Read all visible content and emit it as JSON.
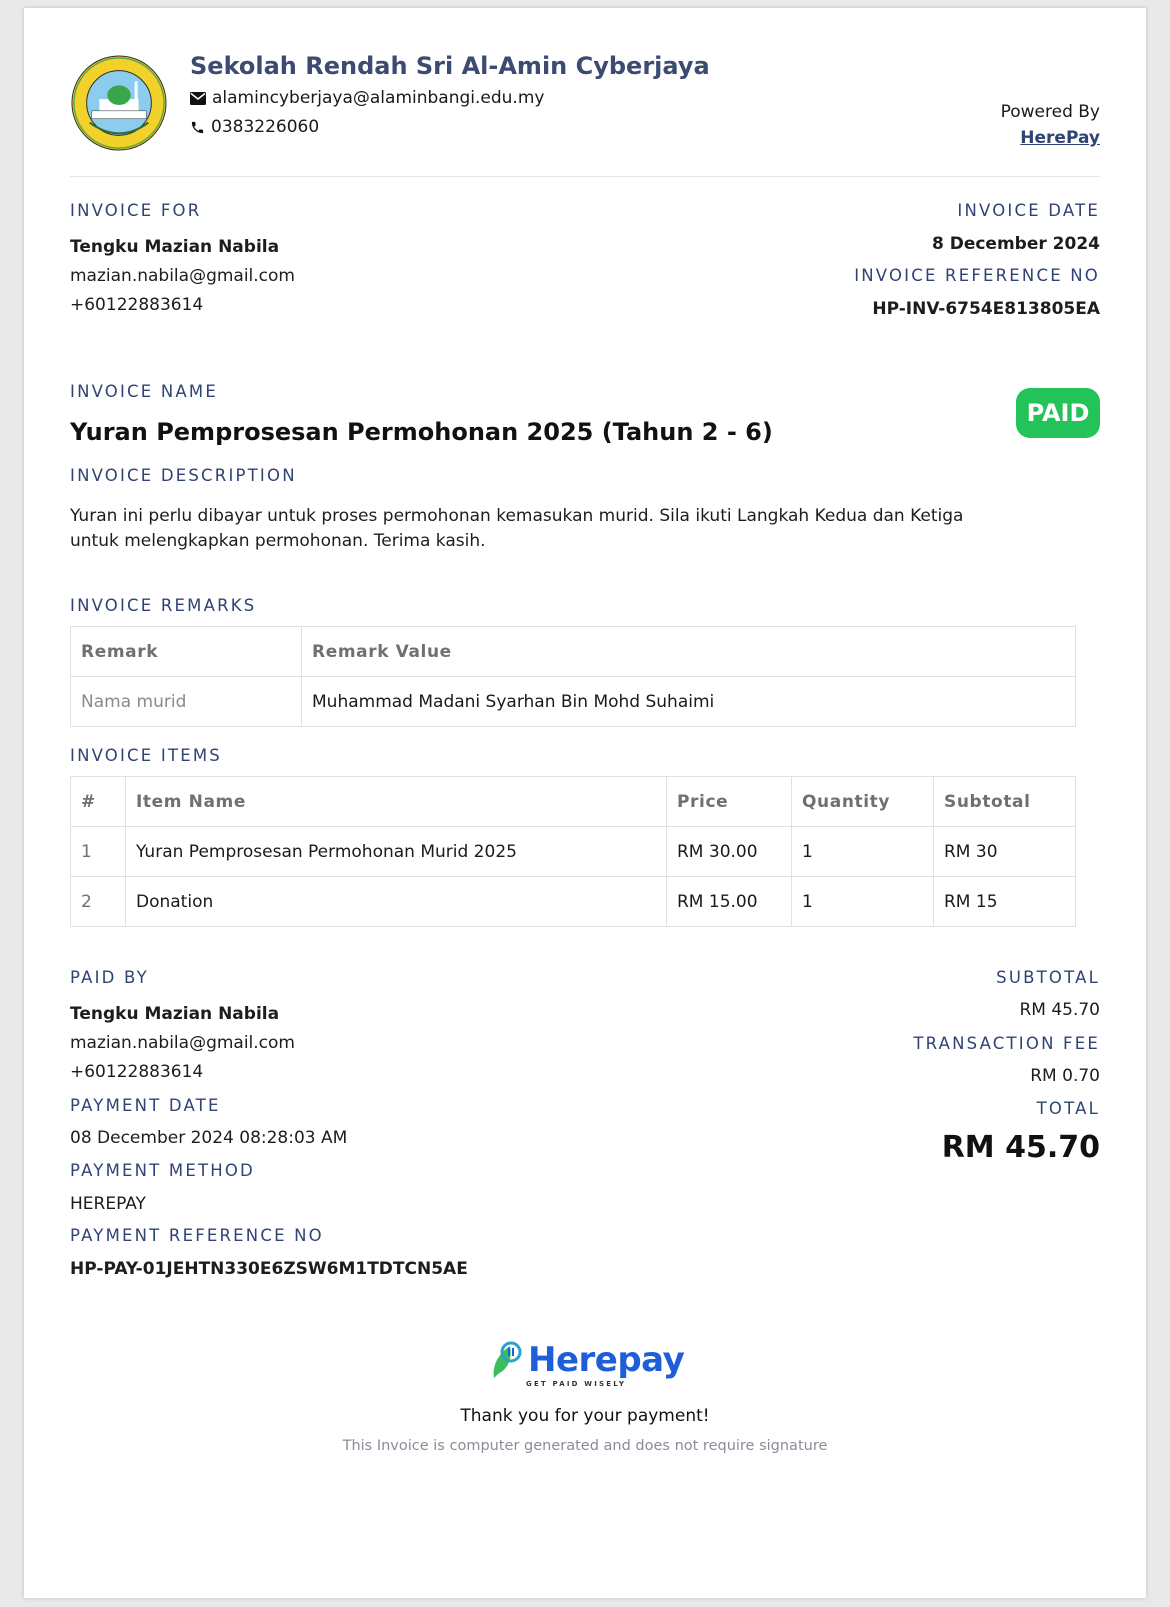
{
  "school": {
    "name": "Sekolah Rendah Sri Al-Amin Cyberjaya",
    "email": "alamincyberjaya@alaminbangi.edu.my",
    "phone": "0383226060",
    "logo_text": "SEKOLAH RENDAH SRI AL-AMIN CYBERJAYA"
  },
  "powered": {
    "label": "Powered By",
    "link": "HerePay"
  },
  "invoice_for": {
    "label": "INVOICE FOR",
    "name": "Tengku Mazian Nabila",
    "email": "mazian.nabila@gmail.com",
    "phone": "+60122883614"
  },
  "invoice_date": {
    "label": "INVOICE DATE",
    "value": "8 December 2024"
  },
  "invoice_ref": {
    "label": "INVOICE REFERENCE NO",
    "value": "HP-INV-6754E813805EA"
  },
  "invoice_name": {
    "label": "INVOICE NAME",
    "value": "Yuran Pemprosesan Permohonan 2025 (Tahun 2 - 6)"
  },
  "status_badge": {
    "text": "PAID",
    "color": "#24c35a"
  },
  "invoice_description": {
    "label": "INVOICE DESCRIPTION",
    "value": "Yuran ini perlu dibayar untuk proses permohonan kemasukan murid. Sila ikuti Langkah Kedua dan Ketiga untuk melengkapkan permohonan. Terima kasih."
  },
  "remarks": {
    "label": "INVOICE REMARKS",
    "headers": [
      "Remark",
      "Remark Value"
    ],
    "rows": [
      [
        "Nama murid",
        "Muhammad Madani Syarhan Bin Mohd Suhaimi"
      ]
    ]
  },
  "items": {
    "label": "INVOICE ITEMS",
    "headers": [
      "#",
      "Item Name",
      "Price",
      "Quantity",
      "Subtotal"
    ],
    "rows": [
      [
        "1",
        "Yuran Pemprosesan Permohonan Murid 2025",
        "RM 30.00",
        "1",
        "RM 30"
      ],
      [
        "2",
        "Donation",
        "RM 15.00",
        "1",
        "RM 15"
      ]
    ]
  },
  "paid_by": {
    "label": "PAID BY",
    "name": "Tengku Mazian Nabila",
    "email": "mazian.nabila@gmail.com",
    "phone": "+60122883614"
  },
  "payment_date": {
    "label": "PAYMENT DATE",
    "value": "08 December 2024 08:28:03 AM"
  },
  "payment_method": {
    "label": "PAYMENT METHOD",
    "value": "HEREPAY"
  },
  "payment_ref": {
    "label": "PAYMENT REFERENCE NO",
    "value": "HP-PAY-01JEHTN330E6ZSW6M1TDTCN5AE"
  },
  "totals": {
    "subtotal_label": "SUBTOTAL",
    "subtotal": "RM 45.70",
    "fee_label": "TRANSACTION FEE",
    "fee": "RM 0.70",
    "total_label": "TOTAL",
    "total": "RM 45.70"
  },
  "footer": {
    "brand": "Herepay",
    "tagline": "GET PAID WISELY",
    "thanks": "Thank you for your payment!",
    "note": "This Invoice is computer generated and does not require signature"
  },
  "colors": {
    "accent": "#2f4374",
    "brand_blue": "#1e5fd8",
    "brand_green": "#3cbf5a"
  }
}
